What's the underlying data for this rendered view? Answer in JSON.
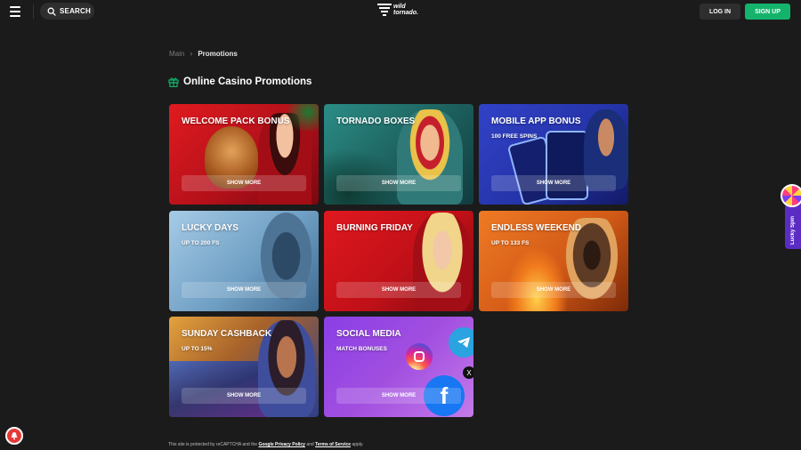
{
  "header": {
    "menu_icon": "hamburger-icon",
    "search_label": "SEARCH",
    "logo_line1": "wild",
    "logo_line2": "tornado.",
    "login_label": "LOG IN",
    "signup_label": "SIGN UP",
    "signup_color": "#14b36c"
  },
  "breadcrumb": {
    "main": "Main",
    "current": "Promotions"
  },
  "page": {
    "title": "Online Casino Promotions",
    "title_icon": "gift-icon"
  },
  "promotions": [
    {
      "title": "WELCOME PACK BONUS",
      "subtitle": "",
      "button": "SHOW MORE",
      "color": "#c0141a"
    },
    {
      "title": "TORNADO BOXES",
      "subtitle": "",
      "button": "SHOW MORE",
      "color": "#1f6f6a"
    },
    {
      "title": "MOBILE APP BONUS",
      "subtitle": "100 FREE SPINS",
      "button": "SHOW MORE",
      "color": "#2a3fb5"
    },
    {
      "title": "LUCKY DAYS",
      "subtitle": "UP TO 200 FS",
      "button": "SHOW MORE",
      "color": "#7fb1d6"
    },
    {
      "title": "BURNING FRIDAY",
      "subtitle": "",
      "button": "SHOW MORE",
      "color": "#c8141b"
    },
    {
      "title": "ENDLESS WEEKEND",
      "subtitle": "UP TO 133 FS",
      "button": "SHOW MORE",
      "color": "#d9661c"
    },
    {
      "title": "SUNDAY CASHBACK",
      "subtitle": "UP TO 15%",
      "button": "SHOW MORE",
      "color": "#d98a2a"
    },
    {
      "title": "SOCIAL MEDIA",
      "subtitle": "MATCH BONUSES",
      "button": "SHOW MORE",
      "color": "#7b3df2"
    }
  ],
  "footer": {
    "text_before": "This site is protected by reCAPTCHA and the ",
    "privacy_link": "Google Privacy Policy",
    "text_middle": " and ",
    "terms_link": "Terms of Service",
    "text_after": " apply."
  },
  "lucky_spin": {
    "label": "Lucky Spin"
  }
}
